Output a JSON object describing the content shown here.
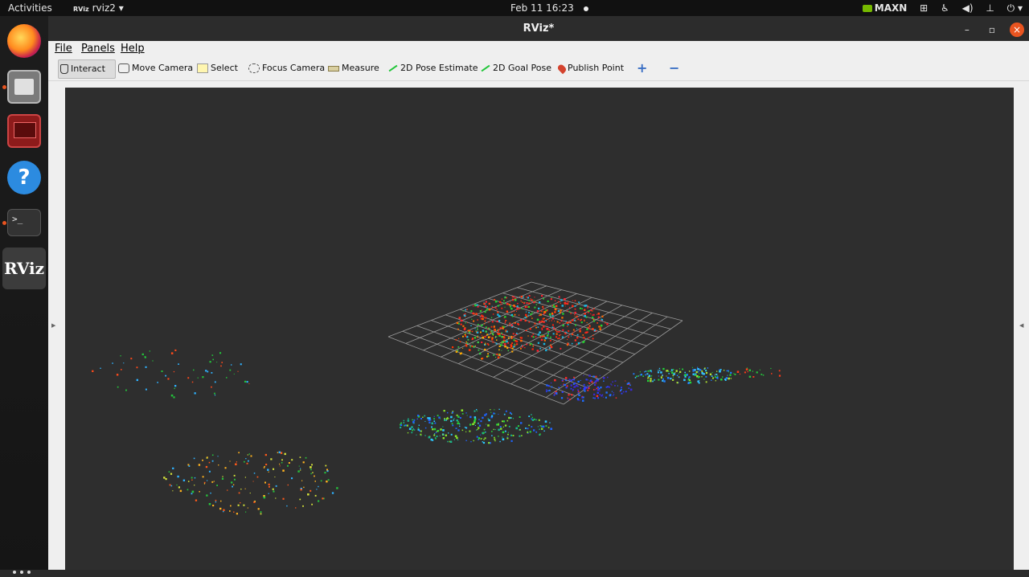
{
  "topbar": {
    "activities": "Activities",
    "app_menu": "rviz2",
    "app_menu_icon": "RViz",
    "clock": "Feb 11  16:23",
    "power_mode": "MAXN"
  },
  "dock": {
    "items": [
      "firefox",
      "files",
      "system-monitor",
      "help",
      "terminal",
      "rviz"
    ],
    "terminal_prompt": ">_",
    "rviz_label": "RViz",
    "help_label": "?"
  },
  "window": {
    "title": "RViz*",
    "controls": {
      "minimize": "–",
      "maximize": "▫",
      "close": "×"
    }
  },
  "menu": {
    "file": "File",
    "panels": "Panels",
    "help": "Help"
  },
  "toolbar": {
    "interact": "Interact",
    "move_camera": "Move Camera",
    "select": "Select",
    "focus_camera": "Focus Camera",
    "measure": "Measure",
    "pose_estimate": "2D Pose Estimate",
    "goal_pose": "2D Goal Pose",
    "publish_point": "Publish Point",
    "add": "+",
    "remove": "−"
  },
  "colors": {
    "viewport_bg": "#2e2e2e",
    "grid": "#a0a0a0",
    "accent_close": "#e95420"
  }
}
